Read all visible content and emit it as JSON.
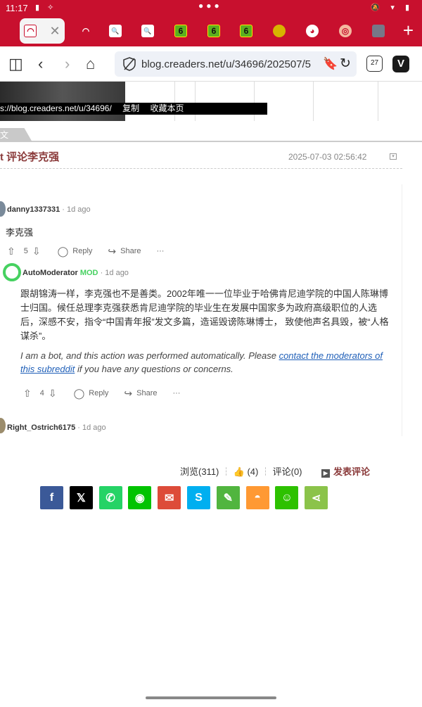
{
  "status_bar": {
    "time": "11:17"
  },
  "tabs": [
    {
      "fav_text": "",
      "color": "#c8102e",
      "active": true
    },
    {
      "fav_text": "",
      "color": "#c8102e",
      "active": false
    },
    {
      "fav_text": "",
      "color": "#ffffff",
      "active": false
    },
    {
      "fav_text": "",
      "color": "#ffffff",
      "active": false
    },
    {
      "fav_text": "6",
      "color": "#5cb01e",
      "active": false
    },
    {
      "fav_text": "6",
      "color": "#5cb01e",
      "active": false
    },
    {
      "fav_text": "6",
      "color": "#5cb01e",
      "active": false
    },
    {
      "fav_text": "",
      "color": "#d7b400",
      "active": false
    },
    {
      "fav_text": "",
      "color": "#ffffff",
      "active": false
    },
    {
      "fav_text": "",
      "color": "#f4b8a0",
      "active": false
    },
    {
      "fav_text": "",
      "color": "#556",
      "active": false
    }
  ],
  "address_bar": {
    "url": "blog.creaders.net/u/34696/202507/5",
    "tab_count": "27"
  },
  "page": {
    "url_strip_url": "s://blog.creaders.net/u/34696/",
    "url_strip_copy": "复制",
    "url_strip_bookmark": "收藏本页",
    "section_label": "文",
    "post_title": "t 评论李克强",
    "post_date": "2025-07-03 02:56:42"
  },
  "reddit": {
    "comment1": {
      "user": "danny1337331",
      "meta": "· 1d ago",
      "body": "李克强",
      "votes": "5",
      "reply": "Reply",
      "share": "Share",
      "more": "···"
    },
    "mod_comment": {
      "user": "AutoModerator",
      "tag": "MOD",
      "meta": "· 1d ago",
      "body": "跟胡锦涛一样，李克强也不是善类。2002年唯一一位毕业于哈佛肯尼迪学院的中国人陈琳博士归国。候任总理李克强获悉肯尼迪学院的毕业生在发展中国家多为政府高级职位的人选后，深感不安，指令“中国青年报”发文多篇，造谣毁谤陈琳博士， 致使他声名具毁，被“人格谋杀”。",
      "note_start": "I am a bot, and this action was performed automatically. Please ",
      "note_link": "contact the moderators of this subreddit",
      "note_end": " if you have any questions or concerns.",
      "votes": "4",
      "reply": "Reply",
      "share": "Share",
      "more": "···"
    },
    "comment3": {
      "user": "Right_Ostrich6175",
      "meta": "· 1d ago"
    }
  },
  "stats": {
    "views": "浏览(311)",
    "likes": "(4)",
    "comments": "评论(0)",
    "write_comment": "发表评论"
  },
  "share_buttons": [
    {
      "name": "facebook",
      "glyph": "f",
      "color": "#3b5998"
    },
    {
      "name": "x",
      "glyph": "X",
      "color": "#000000"
    },
    {
      "name": "whatsapp",
      "glyph": "✆",
      "color": "#25d366"
    },
    {
      "name": "line",
      "glyph": "◉",
      "color": "#00c300"
    },
    {
      "name": "email",
      "glyph": "✉",
      "color": "#dd4b39"
    },
    {
      "name": "skype",
      "glyph": "S",
      "color": "#00aff0"
    },
    {
      "name": "evernote",
      "glyph": "✎",
      "color": "#51b53f"
    },
    {
      "name": "weibo",
      "glyph": "W",
      "color": "#ff9933"
    },
    {
      "name": "wechat",
      "glyph": "☺",
      "color": "#2dc100"
    },
    {
      "name": "share",
      "glyph": "<",
      "color": "#8bc34a"
    }
  ]
}
